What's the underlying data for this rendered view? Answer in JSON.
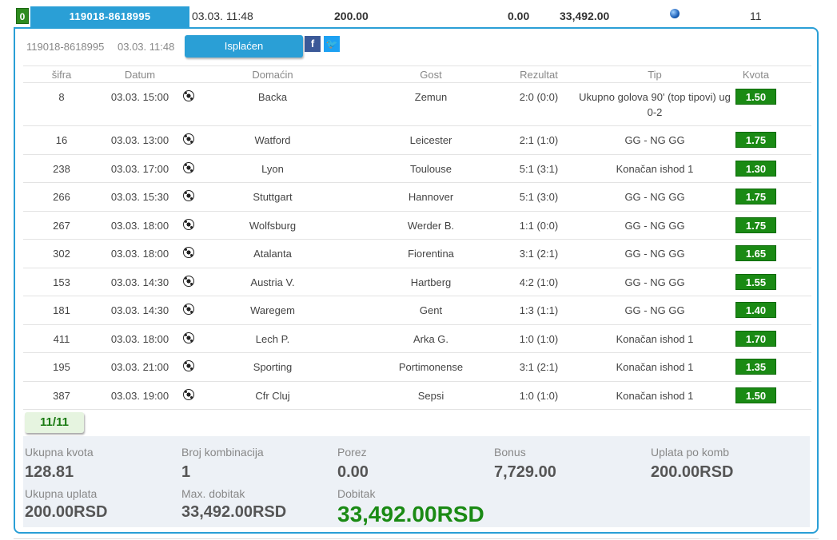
{
  "top_row": {
    "status_number": "0",
    "ticket_id": "119018-8618995",
    "datetime": "03.03. 11:48",
    "stake": "200.00",
    "tax": "0.00",
    "win": "33,492.00",
    "status_icon": "globe-icon",
    "count": "11"
  },
  "ticket": {
    "id": "119018-8618995",
    "datetime": "03.03. 11:48",
    "status_label": "Isplaćen",
    "share_facebook": "f",
    "share_twitter": "🐦"
  },
  "table": {
    "headers": [
      "šifra",
      "Datum",
      "Domaćin",
      "Gost",
      "Rezultat",
      "Tip",
      "Kvota"
    ],
    "rows": [
      {
        "sifra": "8",
        "datum": "03.03. 15:00",
        "domacin": "Backa",
        "gost": "Zemun",
        "rezultat": "2:0 (0:0)",
        "tip": "Ukupno golova 90' (top tipovi) ug 0-2",
        "kvota": "1.50"
      },
      {
        "sifra": "16",
        "datum": "03.03. 13:00",
        "domacin": "Watford",
        "gost": "Leicester",
        "rezultat": "2:1 (1:0)",
        "tip": "GG - NG GG",
        "kvota": "1.75"
      },
      {
        "sifra": "238",
        "datum": "03.03. 17:00",
        "domacin": "Lyon",
        "gost": "Toulouse",
        "rezultat": "5:1 (3:1)",
        "tip": "Konačan ishod 1",
        "kvota": "1.30"
      },
      {
        "sifra": "266",
        "datum": "03.03. 15:30",
        "domacin": "Stuttgart",
        "gost": "Hannover",
        "rezultat": "5:1 (3:0)",
        "tip": "GG - NG GG",
        "kvota": "1.75"
      },
      {
        "sifra": "267",
        "datum": "03.03. 18:00",
        "domacin": "Wolfsburg",
        "gost": "Werder B.",
        "rezultat": "1:1 (0:0)",
        "tip": "GG - NG GG",
        "kvota": "1.75"
      },
      {
        "sifra": "302",
        "datum": "03.03. 18:00",
        "domacin": "Atalanta",
        "gost": "Fiorentina",
        "rezultat": "3:1 (2:1)",
        "tip": "GG - NG GG",
        "kvota": "1.65"
      },
      {
        "sifra": "153",
        "datum": "03.03. 14:30",
        "domacin": "Austria V.",
        "gost": "Hartberg",
        "rezultat": "4:2 (1:0)",
        "tip": "GG - NG GG",
        "kvota": "1.55"
      },
      {
        "sifra": "181",
        "datum": "03.03. 14:30",
        "domacin": "Waregem",
        "gost": "Gent",
        "rezultat": "1:3 (1:1)",
        "tip": "GG - NG GG",
        "kvota": "1.40"
      },
      {
        "sifra": "411",
        "datum": "03.03. 18:00",
        "domacin": "Lech P.",
        "gost": "Arka G.",
        "rezultat": "1:0 (1:0)",
        "tip": "Konačan ishod 1",
        "kvota": "1.70"
      },
      {
        "sifra": "195",
        "datum": "03.03. 21:00",
        "domacin": "Sporting",
        "gost": "Portimonense",
        "rezultat": "3:1 (2:1)",
        "tip": "Konačan ishod 1",
        "kvota": "1.35"
      },
      {
        "sifra": "387",
        "datum": "03.03. 19:00",
        "domacin": "Cfr Cluj",
        "gost": "Sepsi",
        "rezultat": "1:0 (1:0)",
        "tip": "Konačan ishod 1",
        "kvota": "1.50"
      }
    ],
    "sport_icon": "soccer-ball-icon"
  },
  "matches_count": "11/11",
  "summary": {
    "ukupna_kvota_label": "Ukupna kvota",
    "ukupna_kvota": "128.81",
    "broj_kombinacija_label": "Broj kombinacija",
    "broj_kombinacija": "1",
    "porez_label": "Porez",
    "porez": "0.00",
    "bonus_label": "Bonus",
    "bonus": "7,729.00",
    "uplata_po_komb_label": "Uplata po komb",
    "uplata_po_komb": "200.00RSD",
    "ukupna_uplata_label": "Ukupna uplata",
    "ukupna_uplata": "200.00RSD",
    "max_dobitak_label": "Max. dobitak",
    "max_dobitak": "33,492.00RSD",
    "dobitak_label": "Dobitak",
    "dobitak": "33,492.00RSD"
  },
  "colors": {
    "accent": "#2a9fd6",
    "odds_green": "#1a8a14",
    "facebook": "#3b5998",
    "twitter": "#1da1f2",
    "summary_bg": "#edf1f6"
  }
}
